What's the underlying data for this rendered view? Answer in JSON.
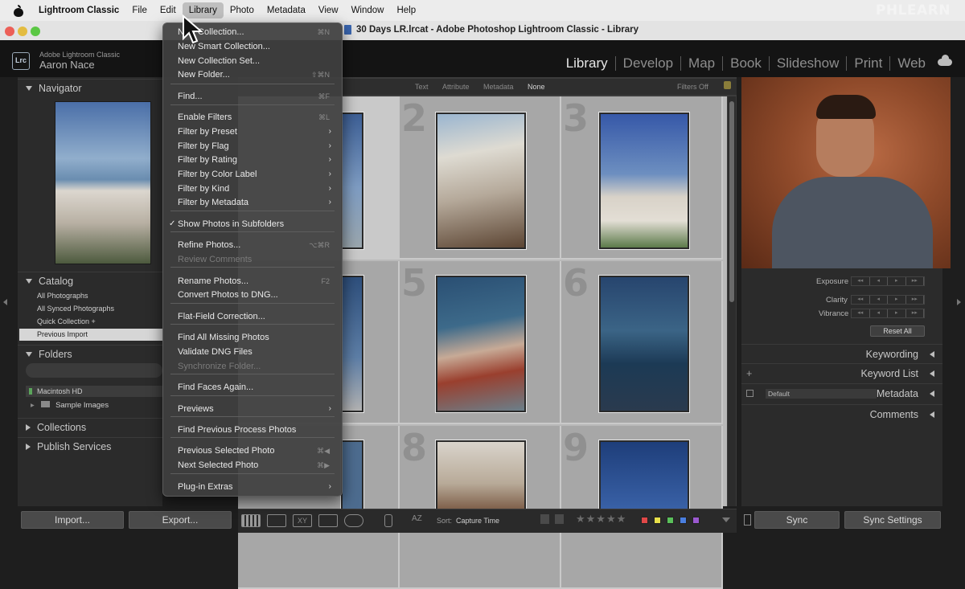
{
  "menubar": {
    "app": "Lightroom Classic",
    "items": [
      "File",
      "Edit",
      "Library",
      "Photo",
      "Metadata",
      "View",
      "Window",
      "Help"
    ],
    "active": "Library",
    "watermark": "PHLEARN"
  },
  "window": {
    "title": "30 Days LR.lrcat - Adobe Photoshop Lightroom Classic - Library"
  },
  "identity": {
    "badge": "Lrc",
    "line1": "Adobe Lightroom Classic",
    "line2": "Aaron Nace"
  },
  "modules": [
    "Library",
    "Develop",
    "Map",
    "Book",
    "Slideshow",
    "Print",
    "Web"
  ],
  "left_panel": {
    "navigator": "Navigator",
    "catalog": "Catalog",
    "catalog_items": [
      "All Photographs",
      "All Synced Photographs",
      "Quick Collection  +",
      "Previous Import"
    ],
    "folders": "Folders",
    "volume": "Macintosh HD",
    "folder_item": "Sample Images",
    "collections": "Collections",
    "publish": "Publish Services",
    "import_btn": "Import...",
    "export_btn": "Export..."
  },
  "filter_bar": {
    "items": [
      "Text",
      "Attribute",
      "Metadata",
      "None"
    ],
    "status": "Filters Off"
  },
  "grid": {
    "cell_numbers": [
      "2",
      "3",
      "5",
      "6",
      "8",
      "9"
    ]
  },
  "toolbar": {
    "sort_label": "Sort:",
    "sort_value": "Capture Time",
    "colors": [
      "#e04848",
      "#e8e04a",
      "#5ac05a",
      "#4a7fe0",
      "#9b59d0"
    ]
  },
  "right_panel": {
    "exposure": "Exposure",
    "clarity": "Clarity",
    "vibrance": "Vibrance",
    "reset": "Reset All",
    "keywording": "Keywording",
    "keyword_list": "Keyword List",
    "metadata": "Metadata",
    "metadata_preset": "Default",
    "comments": "Comments",
    "sync": "Sync",
    "sync_settings": "Sync Settings"
  },
  "library_menu": {
    "items": [
      {
        "label": "New Collection...",
        "shortcut": "⌘N"
      },
      {
        "label": "New Smart Collection...",
        "shortcut": ""
      },
      {
        "label": "New Collection Set...",
        "shortcut": ""
      },
      {
        "label": "New Folder...",
        "shortcut": "⇧⌘N"
      },
      {
        "label": "Find...",
        "shortcut": "⌘F"
      },
      {
        "label": "Enable Filters",
        "shortcut": "⌘L"
      },
      {
        "label": "Filter by Preset",
        "submenu": true
      },
      {
        "label": "Filter by Flag",
        "submenu": true
      },
      {
        "label": "Filter by Rating",
        "submenu": true
      },
      {
        "label": "Filter by Color Label",
        "submenu": true
      },
      {
        "label": "Filter by Kind",
        "submenu": true
      },
      {
        "label": "Filter by Metadata",
        "submenu": true
      },
      {
        "label": "Show Photos in Subfolders",
        "checked": true
      },
      {
        "label": "Refine Photos...",
        "shortcut": "⌥⌘R"
      },
      {
        "label": "Review Comments",
        "disabled": true
      },
      {
        "label": "Rename Photos...",
        "shortcut": "F2"
      },
      {
        "label": "Convert Photos to DNG...",
        "shortcut": ""
      },
      {
        "label": "Flat-Field Correction...",
        "shortcut": ""
      },
      {
        "label": "Find All Missing Photos",
        "shortcut": ""
      },
      {
        "label": "Validate DNG Files",
        "shortcut": ""
      },
      {
        "label": "Synchronize Folder...",
        "disabled": true
      },
      {
        "label": "Find Faces Again...",
        "shortcut": ""
      },
      {
        "label": "Previews",
        "submenu": true
      },
      {
        "label": "Find Previous Process Photos",
        "shortcut": ""
      },
      {
        "label": "Previous Selected Photo",
        "shortcut": "⌘◀"
      },
      {
        "label": "Next Selected Photo",
        "shortcut": "⌘▶"
      },
      {
        "label": "Plug-in Extras",
        "submenu": true
      }
    ]
  }
}
